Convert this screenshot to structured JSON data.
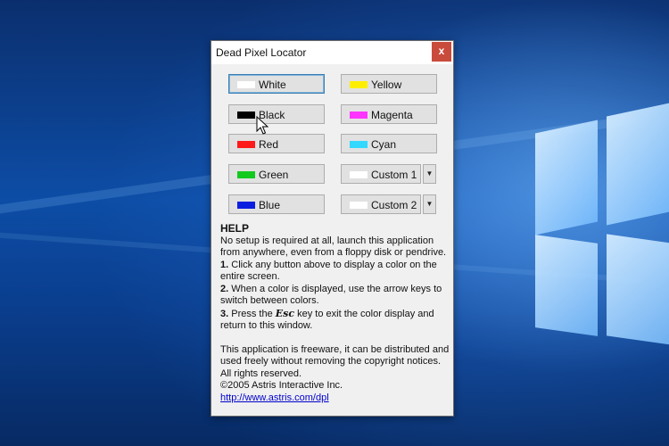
{
  "window": {
    "title": "Dead Pixel Locator",
    "close_label": "x"
  },
  "buttons": {
    "white": {
      "label": "White",
      "color": "#ffffff"
    },
    "black": {
      "label": "Black",
      "color": "#000000"
    },
    "red": {
      "label": "Red",
      "color": "#ff1a1a"
    },
    "green": {
      "label": "Green",
      "color": "#12c91e"
    },
    "blue": {
      "label": "Blue",
      "color": "#0a1ee0"
    },
    "yellow": {
      "label": "Yellow",
      "color": "#ffee00"
    },
    "magenta": {
      "label": "Magenta",
      "color": "#ff33ff"
    },
    "cyan": {
      "label": "Cyan",
      "color": "#33d8ff"
    },
    "custom1": {
      "label": "Custom 1",
      "color": "#ffffff"
    },
    "custom2": {
      "label": "Custom 2",
      "color": "#ffffff"
    }
  },
  "help": {
    "heading": "HELP",
    "intro": "No setup is required at all, launch this application from anywhere, even from a floppy disk or pendrive.",
    "step1_num": "1.",
    "step1_text": "Click any button above to display a color on the entire screen.",
    "step2_num": "2.",
    "step2_text": "When a color is displayed, use the arrow keys to switch between colors.",
    "step3_num": "3.",
    "step3_pre": "Press the",
    "step3_key": "Esc",
    "step3_post": "key to exit the color display and return to this window.",
    "freeware": "This application is freeware, it can be distributed and used freely without removing the copyright notices. All rights reserved.",
    "copyright": "©2005 Astris Interactive Inc.",
    "link": "http://www.astris.com/dpl"
  }
}
